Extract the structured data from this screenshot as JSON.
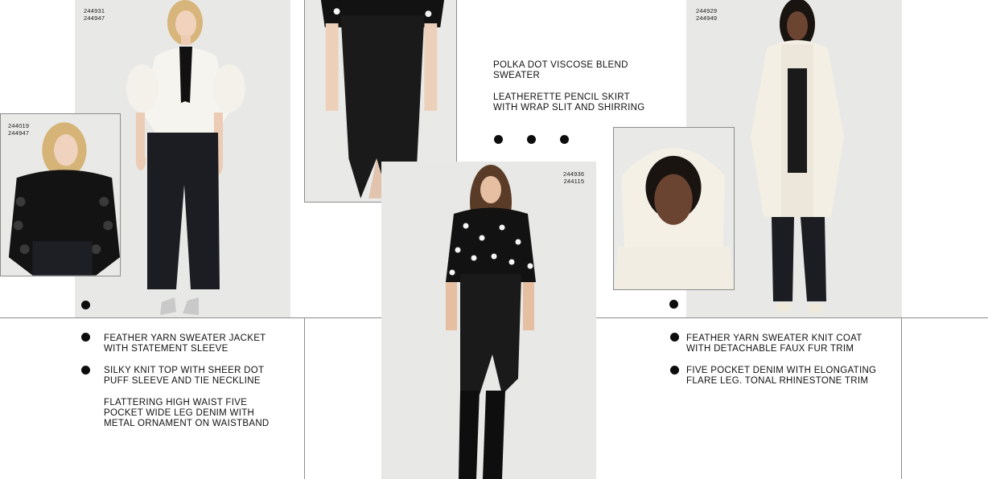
{
  "look1": {
    "main_codes": [
      "244931",
      "244947"
    ],
    "inset_codes": [
      "244019",
      "244947"
    ],
    "items": [
      "FEATHER YARN SWEATER JACKET\nWITH STATEMENT SLEEVE",
      "SILKY KNIT TOP WITH SHEER DOT\nPUFF SLEEVE AND TIE NECKLINE",
      "FLATTERING HIGH WAIST FIVE\nPOCKET WIDE LEG DENIM WITH\nMETAL ORNAMENT ON WAISTBAND"
    ]
  },
  "look2": {
    "codes": [
      "244936",
      "244115"
    ],
    "items": [
      "POLKA DOT VISCOSE BLEND\nSWEATER",
      "LEATHERETTE PENCIL SKIRT\nWITH WRAP SLIT AND SHIRRING"
    ]
  },
  "look3": {
    "codes": [
      "244929",
      "244949"
    ],
    "items": [
      "FEATHER YARN SWEATER KNIT COAT\nWITH DETACHABLE FAUX FUR TRIM",
      "FIVE POCKET DENIM WITH ELONGATING\nFLARE LEG. TONAL RHINESTONE TRIM"
    ]
  },
  "colors": {
    "text": "#111111",
    "line": "#8c8c8c",
    "dot": "#0d0d0d",
    "photo_bg": "#e9e9e7"
  }
}
